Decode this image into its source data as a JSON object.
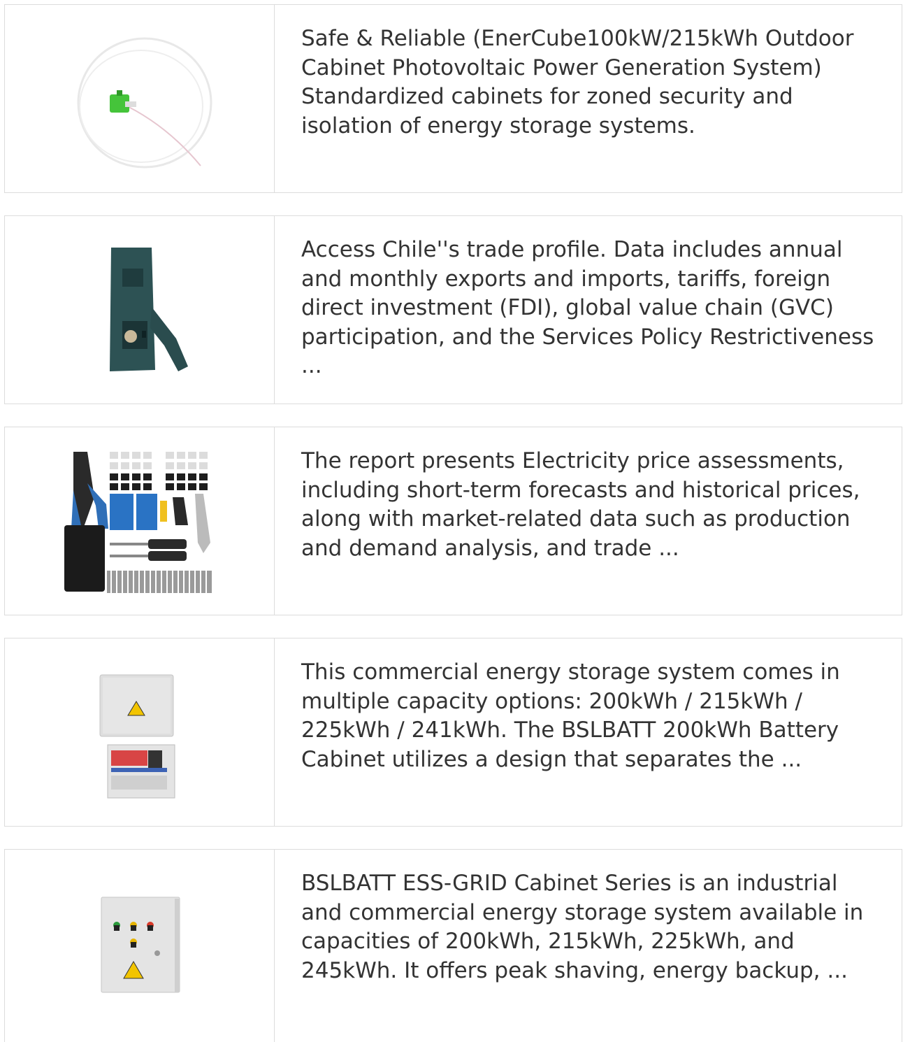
{
  "items": [
    {
      "image": "fiber-pigtail-connector",
      "text": "Safe & Reliable (EnerCube100kW/215kWh Outdoor Cabinet Photovoltaic Power Generation System) Standardized cabinets for zoned security and isolation of energy storage systems."
    },
    {
      "image": "crimping-tool",
      "text": "Access Chile''s trade profile. Data includes annual and monthly exports and imports, tariffs, foreign direct investment (FDI), global value chain (GVC) participation, and the Services Policy Restrictiveness ..."
    },
    {
      "image": "network-tool-kit",
      "text": "The report presents Electricity price assessments, including short-term forecasts and historical prices, along with market-related data such as production and demand analysis, and trade ..."
    },
    {
      "image": "pv-combiner-box",
      "text": "This commercial energy storage system comes in multiple capacity options: 200kWh / 215kWh / 225kWh / 241kWh. The BSLBATT 200kWh Battery Cabinet utilizes a design that separates the ..."
    },
    {
      "image": "electrical-control-cabinet",
      "text": "BSLBATT ESS-GRID Cabinet Series is an industrial and commercial energy storage system available in capacities of 200kWh, 215kWh, 225kWh, and 245kWh. It offers peak shaving, energy backup, ..."
    }
  ]
}
